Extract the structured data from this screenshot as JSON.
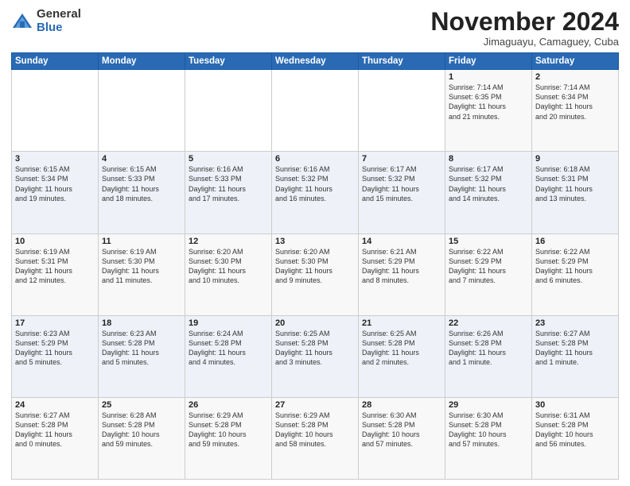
{
  "logo": {
    "general": "General",
    "blue": "Blue"
  },
  "header": {
    "month": "November 2024",
    "location": "Jimaguayu, Camaguey, Cuba"
  },
  "weekdays": [
    "Sunday",
    "Monday",
    "Tuesday",
    "Wednesday",
    "Thursday",
    "Friday",
    "Saturday"
  ],
  "weeks": [
    [
      {
        "day": "",
        "info": ""
      },
      {
        "day": "",
        "info": ""
      },
      {
        "day": "",
        "info": ""
      },
      {
        "day": "",
        "info": ""
      },
      {
        "day": "",
        "info": ""
      },
      {
        "day": "1",
        "info": "Sunrise: 7:14 AM\nSunset: 6:35 PM\nDaylight: 11 hours\nand 21 minutes."
      },
      {
        "day": "2",
        "info": "Sunrise: 7:14 AM\nSunset: 6:34 PM\nDaylight: 11 hours\nand 20 minutes."
      }
    ],
    [
      {
        "day": "3",
        "info": "Sunrise: 6:15 AM\nSunset: 5:34 PM\nDaylight: 11 hours\nand 19 minutes."
      },
      {
        "day": "4",
        "info": "Sunrise: 6:15 AM\nSunset: 5:33 PM\nDaylight: 11 hours\nand 18 minutes."
      },
      {
        "day": "5",
        "info": "Sunrise: 6:16 AM\nSunset: 5:33 PM\nDaylight: 11 hours\nand 17 minutes."
      },
      {
        "day": "6",
        "info": "Sunrise: 6:16 AM\nSunset: 5:32 PM\nDaylight: 11 hours\nand 16 minutes."
      },
      {
        "day": "7",
        "info": "Sunrise: 6:17 AM\nSunset: 5:32 PM\nDaylight: 11 hours\nand 15 minutes."
      },
      {
        "day": "8",
        "info": "Sunrise: 6:17 AM\nSunset: 5:32 PM\nDaylight: 11 hours\nand 14 minutes."
      },
      {
        "day": "9",
        "info": "Sunrise: 6:18 AM\nSunset: 5:31 PM\nDaylight: 11 hours\nand 13 minutes."
      }
    ],
    [
      {
        "day": "10",
        "info": "Sunrise: 6:19 AM\nSunset: 5:31 PM\nDaylight: 11 hours\nand 12 minutes."
      },
      {
        "day": "11",
        "info": "Sunrise: 6:19 AM\nSunset: 5:30 PM\nDaylight: 11 hours\nand 11 minutes."
      },
      {
        "day": "12",
        "info": "Sunrise: 6:20 AM\nSunset: 5:30 PM\nDaylight: 11 hours\nand 10 minutes."
      },
      {
        "day": "13",
        "info": "Sunrise: 6:20 AM\nSunset: 5:30 PM\nDaylight: 11 hours\nand 9 minutes."
      },
      {
        "day": "14",
        "info": "Sunrise: 6:21 AM\nSunset: 5:29 PM\nDaylight: 11 hours\nand 8 minutes."
      },
      {
        "day": "15",
        "info": "Sunrise: 6:22 AM\nSunset: 5:29 PM\nDaylight: 11 hours\nand 7 minutes."
      },
      {
        "day": "16",
        "info": "Sunrise: 6:22 AM\nSunset: 5:29 PM\nDaylight: 11 hours\nand 6 minutes."
      }
    ],
    [
      {
        "day": "17",
        "info": "Sunrise: 6:23 AM\nSunset: 5:29 PM\nDaylight: 11 hours\nand 5 minutes."
      },
      {
        "day": "18",
        "info": "Sunrise: 6:23 AM\nSunset: 5:28 PM\nDaylight: 11 hours\nand 5 minutes."
      },
      {
        "day": "19",
        "info": "Sunrise: 6:24 AM\nSunset: 5:28 PM\nDaylight: 11 hours\nand 4 minutes."
      },
      {
        "day": "20",
        "info": "Sunrise: 6:25 AM\nSunset: 5:28 PM\nDaylight: 11 hours\nand 3 minutes."
      },
      {
        "day": "21",
        "info": "Sunrise: 6:25 AM\nSunset: 5:28 PM\nDaylight: 11 hours\nand 2 minutes."
      },
      {
        "day": "22",
        "info": "Sunrise: 6:26 AM\nSunset: 5:28 PM\nDaylight: 11 hours\nand 1 minute."
      },
      {
        "day": "23",
        "info": "Sunrise: 6:27 AM\nSunset: 5:28 PM\nDaylight: 11 hours\nand 1 minute."
      }
    ],
    [
      {
        "day": "24",
        "info": "Sunrise: 6:27 AM\nSunset: 5:28 PM\nDaylight: 11 hours\nand 0 minutes."
      },
      {
        "day": "25",
        "info": "Sunrise: 6:28 AM\nSunset: 5:28 PM\nDaylight: 10 hours\nand 59 minutes."
      },
      {
        "day": "26",
        "info": "Sunrise: 6:29 AM\nSunset: 5:28 PM\nDaylight: 10 hours\nand 59 minutes."
      },
      {
        "day": "27",
        "info": "Sunrise: 6:29 AM\nSunset: 5:28 PM\nDaylight: 10 hours\nand 58 minutes."
      },
      {
        "day": "28",
        "info": "Sunrise: 6:30 AM\nSunset: 5:28 PM\nDaylight: 10 hours\nand 57 minutes."
      },
      {
        "day": "29",
        "info": "Sunrise: 6:30 AM\nSunset: 5:28 PM\nDaylight: 10 hours\nand 57 minutes."
      },
      {
        "day": "30",
        "info": "Sunrise: 6:31 AM\nSunset: 5:28 PM\nDaylight: 10 hours\nand 56 minutes."
      }
    ]
  ]
}
